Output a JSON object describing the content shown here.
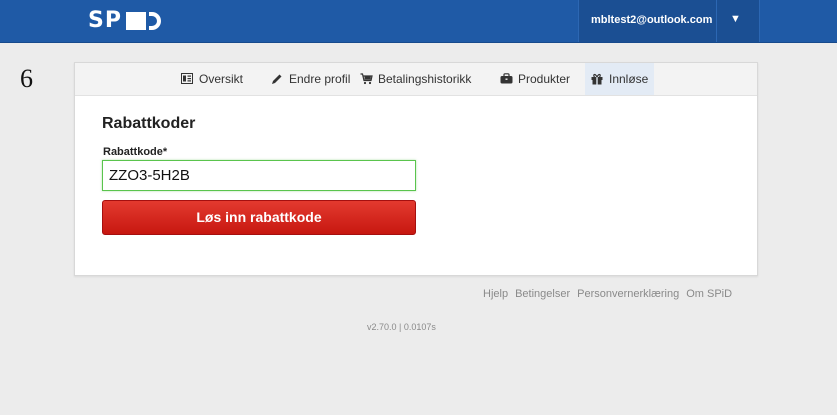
{
  "header": {
    "logo_text": "SP",
    "user_email": "mbltest2@outlook.com",
    "dropdown_caret": "▼",
    "brand_color": "#1f5aa6"
  },
  "step_number": "6",
  "tabs": [
    {
      "label": "Oversikt",
      "icon": "list-icon"
    },
    {
      "label": "Endre profil",
      "icon": "pencil-icon"
    },
    {
      "label": "Betalingshistorikk",
      "icon": "cart-icon"
    },
    {
      "label": "Produkter",
      "icon": "briefcase-icon"
    },
    {
      "label": "Innløse",
      "icon": "gift-icon",
      "active": true
    }
  ],
  "main": {
    "section_title": "Rabattkoder",
    "field_label": "Rabattkode*",
    "field_value": "ZZO3-5H2B",
    "submit_label": "Løs inn rabattkode",
    "submit_color": "#d42117"
  },
  "footer": {
    "links": [
      "Hjelp",
      "Betingelser",
      "Personvernerklæring",
      "Om SPiD"
    ],
    "version": "v2.70.0 | 0.0107s"
  }
}
